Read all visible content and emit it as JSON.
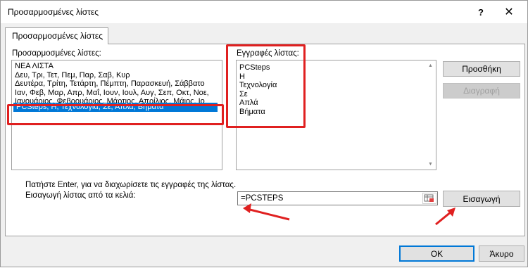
{
  "window": {
    "title": "Προσαρμοσμένες λίστες",
    "help_glyph": "?",
    "close_glyph": "✕"
  },
  "tab": {
    "label": "Προσαρμοσμένες λίστες"
  },
  "custom_lists": {
    "label": "Προσαρμοσμένες λίστες:",
    "items": [
      "ΝΕΑ ΛΙΣΤΑ",
      "Δευ, Τρι, Τετ, Πεμ, Παρ, Σαβ, Κυρ",
      "Δευτέρα, Τρίτη, Τετάρτη, Πέμπτη, Παρασκευή, Σάββατο",
      "Ιαν, Φεβ, Μαρ, Απρ, Μαΐ, Ιουν, Ιουλ, Αυγ, Σεπ, Οκτ, Νοε,",
      "Ιανουάριος, Φεβρουάριος, Μάρτιος, Απρίλιος, Μάιος, Ιο",
      "PCSteps, Η, Τεχνολογία, Σε, Απλά, Βήματα"
    ],
    "selected_index": 5
  },
  "list_entries": {
    "label": "Εγγραφές λίστας:",
    "items": [
      "PCSteps",
      "Η",
      "Τεχνολογία",
      "Σε",
      "Απλά",
      "Βήματα"
    ]
  },
  "buttons": {
    "add": "Προσθήκη",
    "delete": "Διαγραφή",
    "import": "Εισαγωγή",
    "ok": "OK",
    "cancel": "Άκυρο"
  },
  "hint": "Πατήστε Enter, για να διαχωρίσετε τις εγγραφές της λίστας.",
  "import_from_cells": {
    "label": "Εισαγωγή λίστας από τα κελιά:",
    "value": "=PCSTEPS"
  },
  "icons": {
    "help": "question-icon",
    "close": "close-icon",
    "range_select": "range-select-icon",
    "scroll_up": "chevron-up-icon",
    "scroll_down": "chevron-down-icon"
  },
  "colors": {
    "selection": "#0078d7",
    "annotation": "#e02020"
  }
}
